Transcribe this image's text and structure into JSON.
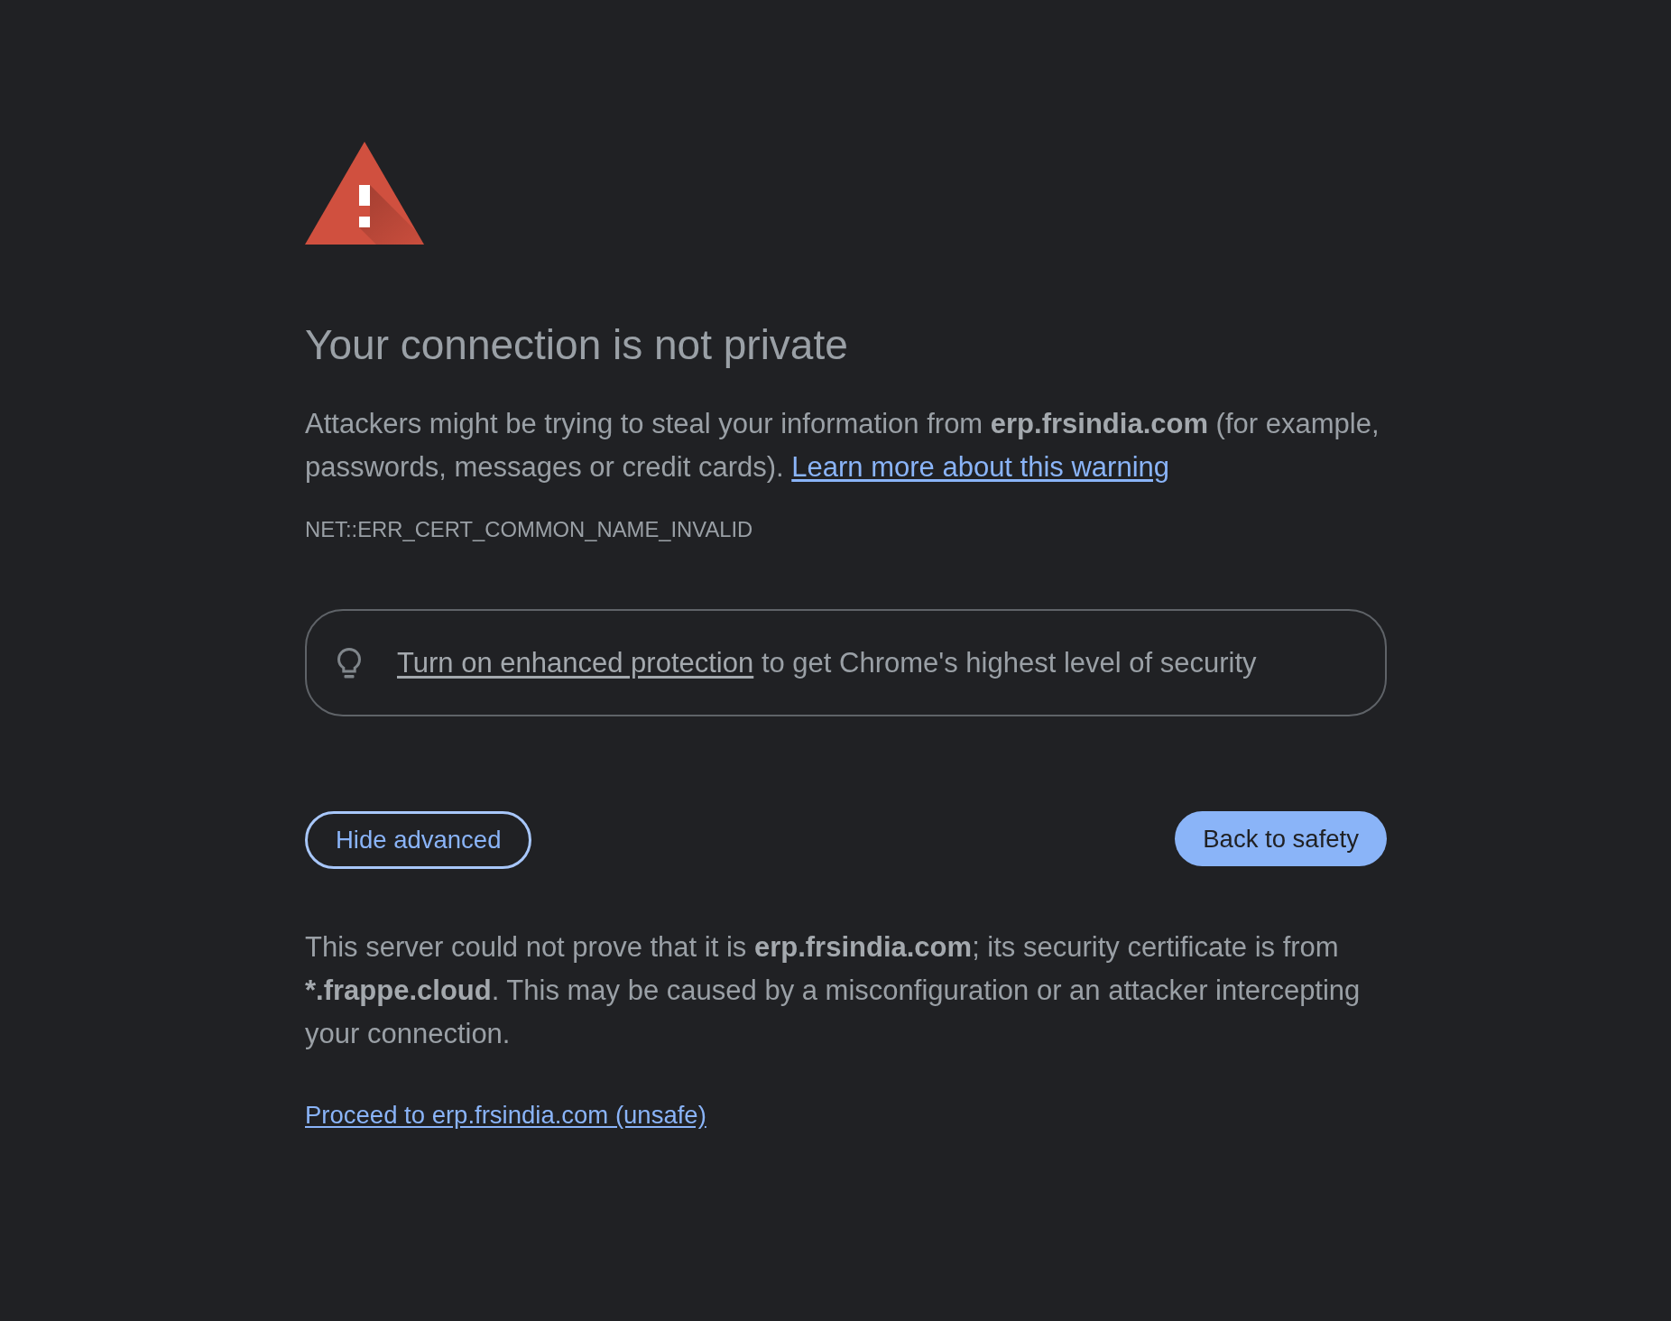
{
  "heading": "Your connection is not private",
  "main_message": {
    "segments": [
      {
        "text": "Attackers might be trying to steal your information from ",
        "bold": false
      },
      {
        "text": "erp.frsindia.com",
        "bold": true
      },
      {
        "text": " (for example, passwords, messages or credit cards).",
        "bold": false
      }
    ],
    "link": "Learn more about this warning"
  },
  "error_code": "NET::ERR_CERT_COMMON_NAME_INVALID",
  "enhanced_protection": {
    "link": "Turn on enhanced protection",
    "text": "to get Chrome's highest level of security"
  },
  "buttons": [
    {
      "label": "Hide advanced",
      "kind": "outlined",
      "focused": true
    },
    {
      "label": "Back to safety",
      "kind": "filled",
      "focused": false
    }
  ],
  "details": {
    "segments": [
      {
        "text": "This server could not prove that it is ",
        "bold": false
      },
      {
        "text": "erp.frsindia.com",
        "bold": true
      },
      {
        "text": "; its security certificate is from ",
        "bold": false
      },
      {
        "text": "*.frappe.cloud",
        "bold": true
      },
      {
        "text": ". This may be caused by a misconfiguration or an attacker intercepting your connection.",
        "bold": false
      }
    ]
  },
  "proceed_link": "Proceed to erp.frsindia.com (unsafe)"
}
